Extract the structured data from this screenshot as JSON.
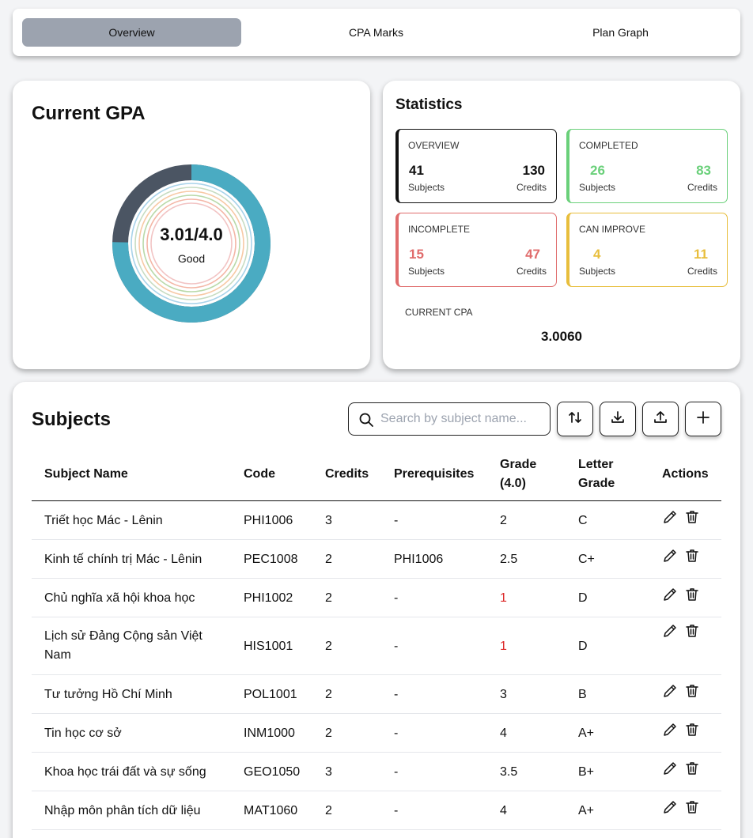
{
  "tabs": [
    {
      "label": "Overview",
      "active": true
    },
    {
      "label": "CPA Marks",
      "active": false
    },
    {
      "label": "Plan Graph",
      "active": false
    }
  ],
  "gpa": {
    "title": "Current GPA",
    "value": "3.01/4.0",
    "label": "Good",
    "gpa_fraction": 0.7525,
    "ring_colors": {
      "fill": "#4aabc2",
      "remainder": "#4b5563",
      "inner": [
        "#a9d3ea",
        "#c7dcc2",
        "#f7c9a5",
        "#b9d9a9",
        "#f4b6a6",
        "#f2c4c4"
      ]
    }
  },
  "statistics": {
    "title": "Statistics",
    "boxes": [
      {
        "title": "OVERVIEW",
        "subjects": "41",
        "subjects_label": "Subjects",
        "credits": "130",
        "credits_label": "Credits",
        "color": "#111111"
      },
      {
        "title": "COMPLETED",
        "subjects": "26",
        "subjects_label": "Subjects",
        "credits": "83",
        "credits_label": "Credits",
        "color": "#6ad07a"
      },
      {
        "title": "INCOMPLETE",
        "subjects": "15",
        "subjects_label": "Subjects",
        "credits": "47",
        "credits_label": "Credits",
        "color": "#e06c6c"
      },
      {
        "title": "CAN IMPROVE",
        "subjects": "4",
        "subjects_label": "Subjects",
        "credits": "11",
        "credits_label": "Credits",
        "color": "#e8be3c"
      }
    ],
    "cpa_title": "CURRENT CPA",
    "cpa_value": "3.0060"
  },
  "subjects": {
    "title": "Subjects",
    "search_placeholder": "Search by subject name...",
    "toolbar": {
      "sort_icon": "sort-arrows-icon",
      "download_icon": "download-icon",
      "upload_icon": "upload-icon",
      "add_icon": "plus-icon"
    },
    "headers": {
      "name": "Subject Name",
      "code": "Code",
      "credits": "Credits",
      "prerequisites": "Prerequisites",
      "grade_line1": "Grade",
      "grade_line2": "(4.0)",
      "letter_line1": "Letter",
      "letter_line2": "Grade",
      "actions": "Actions"
    },
    "rows": [
      {
        "name": "Triết học Mác - Lênin",
        "code": "PHI1006",
        "credits": "3",
        "prerequisites": "-",
        "grade": "2",
        "letter": "C",
        "low": false
      },
      {
        "name": "Kinh tế chính trị Mác - Lênin",
        "code": "PEC1008",
        "credits": "2",
        "prerequisites": "PHI1006",
        "grade": "2.5",
        "letter": "C+",
        "low": false
      },
      {
        "name": "Chủ nghĩa xã hội khoa học",
        "code": "PHI1002",
        "credits": "2",
        "prerequisites": "-",
        "grade": "1",
        "letter": "D",
        "low": true
      },
      {
        "name": "Lịch sử Đảng Cộng sản Việt Nam",
        "code": "HIS1001",
        "credits": "2",
        "prerequisites": "-",
        "grade": "1",
        "letter": "D",
        "low": true
      },
      {
        "name": "Tư tưởng Hồ Chí Minh",
        "code": "POL1001",
        "credits": "2",
        "prerequisites": "-",
        "grade": "3",
        "letter": "B",
        "low": false
      },
      {
        "name": "Tin học cơ sở",
        "code": "INM1000",
        "credits": "2",
        "prerequisites": "-",
        "grade": "4",
        "letter": "A+",
        "low": false
      },
      {
        "name": "Khoa học trái đất và sự sống",
        "code": "GEO1050",
        "credits": "3",
        "prerequisites": "-",
        "grade": "3.5",
        "letter": "B+",
        "low": false
      },
      {
        "name": "Nhập môn phân tích dữ liệu",
        "code": "MAT1060",
        "credits": "2",
        "prerequisites": "-",
        "grade": "4",
        "letter": "A+",
        "low": false
      }
    ],
    "grade_low_color": "#dc2626",
    "edit_icon": "pencil-icon",
    "delete_icon": "trash-icon"
  }
}
